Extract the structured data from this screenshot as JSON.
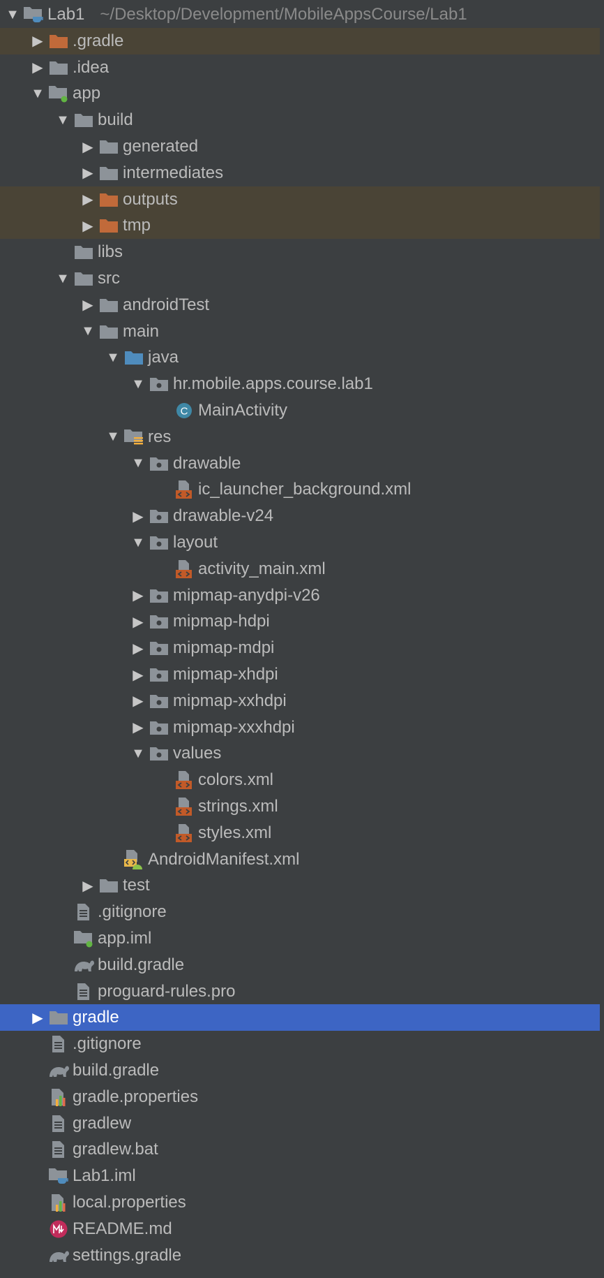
{
  "colors": {
    "background": "#3c3f41",
    "selection": "#3d65c4",
    "ignored": "#4a4436",
    "folder": "#8d9399",
    "excluded_folder": "#c16a3a",
    "source_folder": "#4f8cbd",
    "xml": "#c25a28"
  },
  "tree": [
    {
      "label": "Lab1",
      "extra": "~/Desktop/Development/MobileAppsCourse/Lab1",
      "depth": 0,
      "arrow": "down",
      "icon": "project-folder-icon"
    },
    {
      "label": ".gradle",
      "depth": 1,
      "arrow": "right",
      "icon": "excluded-folder-icon",
      "state": "ignored"
    },
    {
      "label": ".idea",
      "depth": 1,
      "arrow": "right",
      "icon": "folder-icon"
    },
    {
      "label": "app",
      "depth": 1,
      "arrow": "down",
      "icon": "module-folder-icon"
    },
    {
      "label": "build",
      "depth": 2,
      "arrow": "down",
      "icon": "folder-icon"
    },
    {
      "label": "generated",
      "depth": 3,
      "arrow": "right",
      "icon": "folder-icon"
    },
    {
      "label": "intermediates",
      "depth": 3,
      "arrow": "right",
      "icon": "folder-icon"
    },
    {
      "label": "outputs",
      "depth": 3,
      "arrow": "right",
      "icon": "excluded-folder-icon",
      "state": "ignored"
    },
    {
      "label": "tmp",
      "depth": 3,
      "arrow": "right",
      "icon": "excluded-folder-icon",
      "state": "ignored"
    },
    {
      "label": "libs",
      "depth": 2,
      "arrow": "none",
      "icon": "folder-icon"
    },
    {
      "label": "src",
      "depth": 2,
      "arrow": "down",
      "icon": "folder-icon"
    },
    {
      "label": "androidTest",
      "depth": 3,
      "arrow": "right",
      "icon": "folder-icon"
    },
    {
      "label": "main",
      "depth": 3,
      "arrow": "down",
      "icon": "folder-icon"
    },
    {
      "label": "java",
      "depth": 4,
      "arrow": "down",
      "icon": "source-folder-icon"
    },
    {
      "label": "hr.mobile.apps.course.lab1",
      "depth": 5,
      "arrow": "down",
      "icon": "package-icon"
    },
    {
      "label": "MainActivity",
      "depth": 6,
      "arrow": "none",
      "icon": "class-icon"
    },
    {
      "label": "res",
      "depth": 4,
      "arrow": "down",
      "icon": "resource-folder-icon"
    },
    {
      "label": "drawable",
      "depth": 5,
      "arrow": "down",
      "icon": "package-icon"
    },
    {
      "label": "ic_launcher_background.xml",
      "depth": 6,
      "arrow": "none",
      "icon": "xml-file-icon"
    },
    {
      "label": "drawable-v24",
      "depth": 5,
      "arrow": "right",
      "icon": "package-icon"
    },
    {
      "label": "layout",
      "depth": 5,
      "arrow": "down",
      "icon": "package-icon"
    },
    {
      "label": "activity_main.xml",
      "depth": 6,
      "arrow": "none",
      "icon": "xml-file-icon"
    },
    {
      "label": "mipmap-anydpi-v26",
      "depth": 5,
      "arrow": "right",
      "icon": "package-icon"
    },
    {
      "label": "mipmap-hdpi",
      "depth": 5,
      "arrow": "right",
      "icon": "package-icon"
    },
    {
      "label": "mipmap-mdpi",
      "depth": 5,
      "arrow": "right",
      "icon": "package-icon"
    },
    {
      "label": "mipmap-xhdpi",
      "depth": 5,
      "arrow": "right",
      "icon": "package-icon"
    },
    {
      "label": "mipmap-xxhdpi",
      "depth": 5,
      "arrow": "right",
      "icon": "package-icon"
    },
    {
      "label": "mipmap-xxxhdpi",
      "depth": 5,
      "arrow": "right",
      "icon": "package-icon"
    },
    {
      "label": "values",
      "depth": 5,
      "arrow": "down",
      "icon": "package-icon"
    },
    {
      "label": "colors.xml",
      "depth": 6,
      "arrow": "none",
      "icon": "xml-file-icon"
    },
    {
      "label": "strings.xml",
      "depth": 6,
      "arrow": "none",
      "icon": "xml-file-icon"
    },
    {
      "label": "styles.xml",
      "depth": 6,
      "arrow": "none",
      "icon": "xml-file-icon"
    },
    {
      "label": "AndroidManifest.xml",
      "depth": 4,
      "arrow": "none",
      "icon": "manifest-icon"
    },
    {
      "label": "test",
      "depth": 3,
      "arrow": "right",
      "icon": "folder-icon"
    },
    {
      "label": ".gitignore",
      "depth": 2,
      "arrow": "none",
      "icon": "text-file-icon"
    },
    {
      "label": "app.iml",
      "depth": 2,
      "arrow": "none",
      "icon": "module-folder-icon"
    },
    {
      "label": "build.gradle",
      "depth": 2,
      "arrow": "none",
      "icon": "gradle-icon"
    },
    {
      "label": "proguard-rules.pro",
      "depth": 2,
      "arrow": "none",
      "icon": "text-file-icon"
    },
    {
      "label": "gradle",
      "depth": 1,
      "arrow": "right",
      "icon": "folder-icon",
      "state": "selected"
    },
    {
      "label": ".gitignore",
      "depth": 1,
      "arrow": "none",
      "icon": "text-file-icon"
    },
    {
      "label": "build.gradle",
      "depth": 1,
      "arrow": "none",
      "icon": "gradle-icon"
    },
    {
      "label": "gradle.properties",
      "depth": 1,
      "arrow": "none",
      "icon": "properties-file-icon"
    },
    {
      "label": "gradlew",
      "depth": 1,
      "arrow": "none",
      "icon": "text-file-icon"
    },
    {
      "label": "gradlew.bat",
      "depth": 1,
      "arrow": "none",
      "icon": "text-file-icon"
    },
    {
      "label": "Lab1.iml",
      "depth": 1,
      "arrow": "none",
      "icon": "project-folder-icon"
    },
    {
      "label": "local.properties",
      "depth": 1,
      "arrow": "none",
      "icon": "properties-file-icon"
    },
    {
      "label": "README.md",
      "depth": 1,
      "arrow": "none",
      "icon": "markdown-icon"
    },
    {
      "label": "settings.gradle",
      "depth": 1,
      "arrow": "none",
      "icon": "gradle-icon"
    }
  ]
}
